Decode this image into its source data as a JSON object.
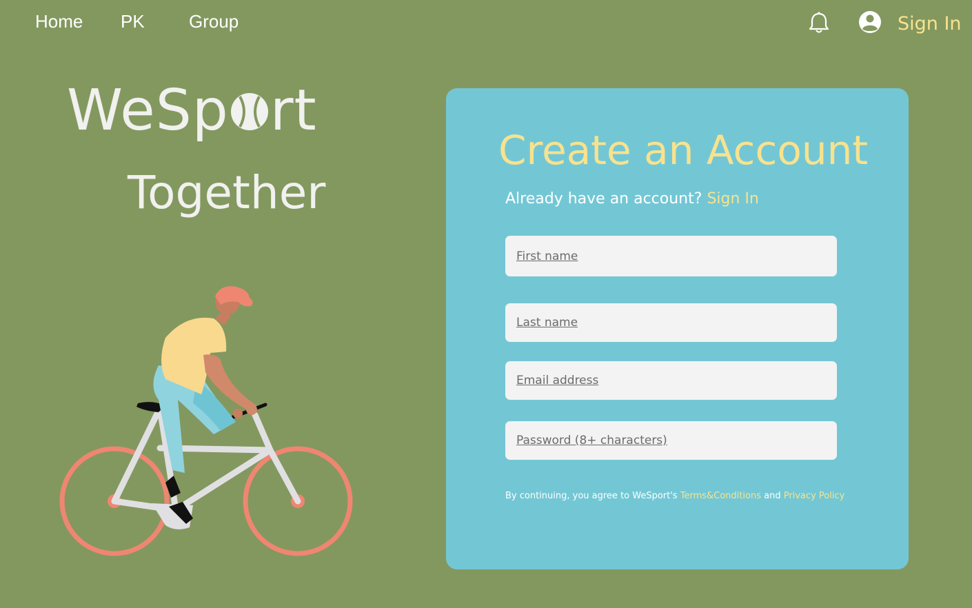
{
  "nav": {
    "home": "Home",
    "pk": "PK",
    "group": "Group",
    "notification_icon": "bell-icon",
    "account_icon": "account-circle-icon",
    "sign_in": "Sign In"
  },
  "hero": {
    "brand_part1": "WeSp",
    "brand_part2": "rt",
    "tagline": "Together",
    "ball_icon": "tennis-ball-icon"
  },
  "form": {
    "title": "Create an Account",
    "have_account_text": "Already have an account?",
    "sign_in_link": "Sign In",
    "first_name_placeholder": "First name",
    "last_name_placeholder": "Last name",
    "email_placeholder": "Email address",
    "password_placeholder": "Password (8+ characters)",
    "terms_prefix": "By continuing, you agree to WeSport's",
    "terms_link": "Terms&Conditions",
    "terms_and": "and",
    "privacy_link": "Privacy Policy"
  },
  "colors": {
    "background": "#83985f",
    "card": "#73c7d5",
    "accent_yellow": "#f9e38d",
    "field": "#f3f3f3"
  }
}
